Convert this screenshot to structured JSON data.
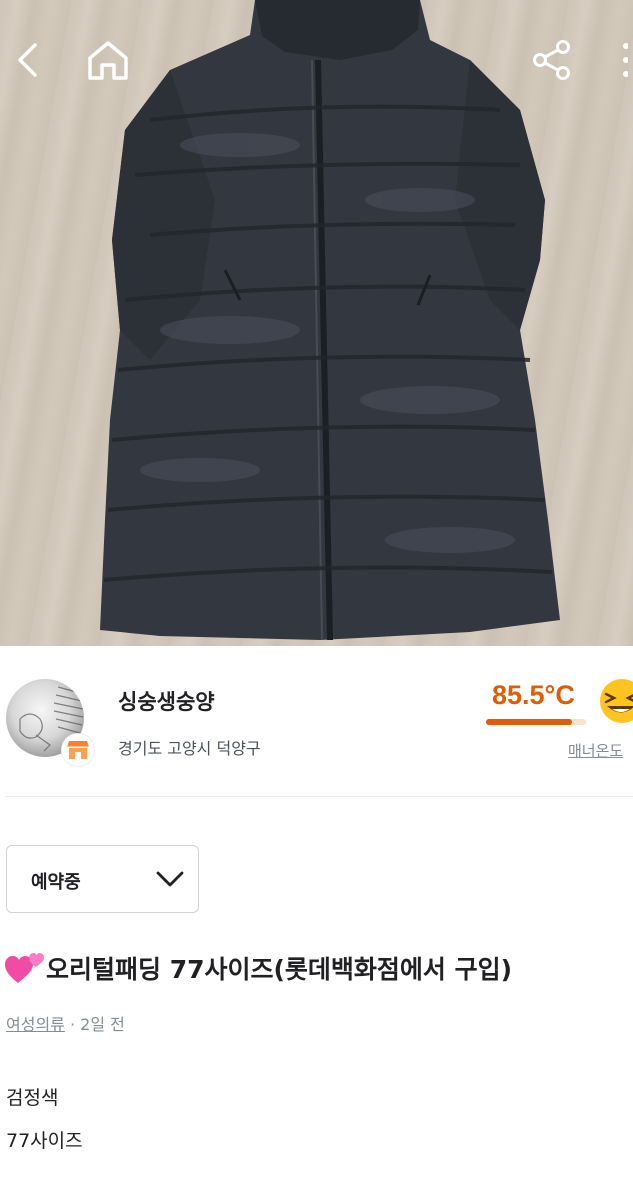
{
  "seller": {
    "nickname": "싱숭생숭양",
    "region": "경기도 고양시 덕양구",
    "manner_temperature": "85.5°C",
    "manner_temperature_value": 85.5,
    "manner_label": "매너온도"
  },
  "status_select": {
    "selected": "예약중"
  },
  "post": {
    "title": "오리털패딩 77사이즈(롯데백화점에서 구입)",
    "category": "여성의류",
    "separator": "·",
    "time_ago": "2일 전",
    "description_lines": [
      "검정색",
      "77사이즈"
    ]
  },
  "icons": {
    "back": "chevron-left-icon",
    "home": "home-icon",
    "share": "share-icon",
    "more": "more-vertical-icon",
    "shop_badge": "shop-icon",
    "temperature_emoji": "laughing-face-icon",
    "status_dropdown": "chevron-down-icon",
    "title_emoji": "two-hearts-icon"
  },
  "colors": {
    "temperature_accent": "#de5d06",
    "primary_text": "#212124",
    "secondary_text": "#868b94"
  }
}
